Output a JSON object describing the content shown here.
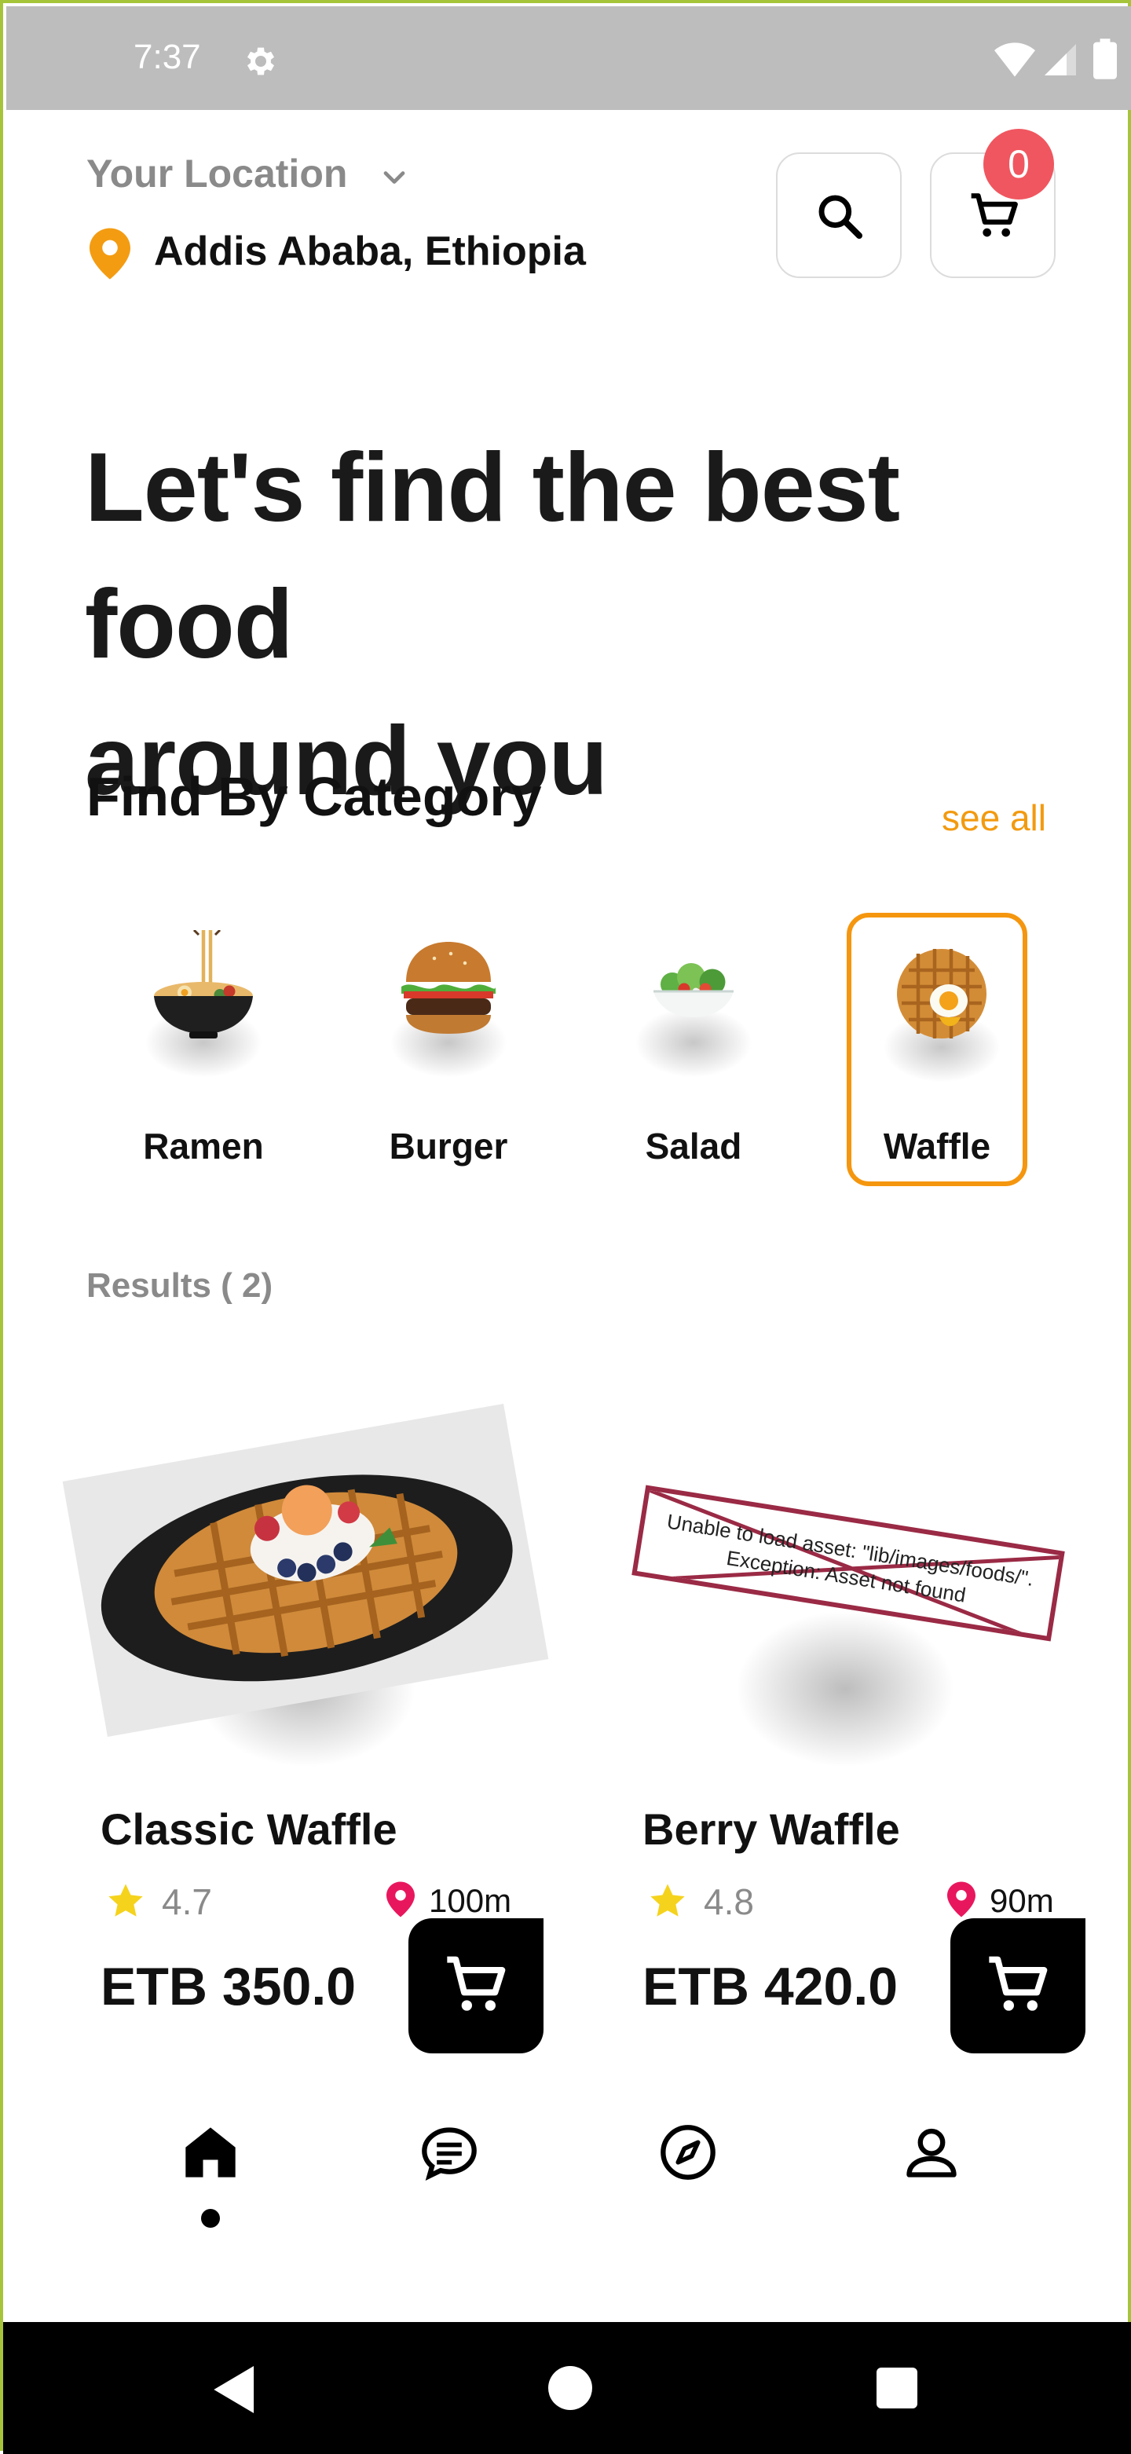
{
  "status_bar": {
    "time": "7:37",
    "icons": [
      "gear-icon",
      "wifi-icon",
      "signal-icon",
      "battery-icon"
    ]
  },
  "header": {
    "location_label": "Your Location",
    "location_value": "Addis Ababa, Ethiopia",
    "cart_count": "0"
  },
  "hero": {
    "line1": "Let's find the best food",
    "line2": "around you"
  },
  "categories": {
    "title": "Find By Category",
    "see_all": "see all",
    "items": [
      {
        "label": "Ramen",
        "icon": "ramen-image"
      },
      {
        "label": "Burger",
        "icon": "burger-image"
      },
      {
        "label": "Salad",
        "icon": "salad-image"
      },
      {
        "label": "Waffle",
        "icon": "waffle-image",
        "selected": true
      }
    ]
  },
  "results": {
    "label": "Results ( 2)",
    "items": [
      {
        "name": "Classic Waffle",
        "rating": "4.7",
        "distance": "100m",
        "price": "ETB 350.0"
      },
      {
        "name": "Berry Waffle",
        "rating": "4.8",
        "distance": "90m",
        "price": "ETB 420.0",
        "image_error": "Unable to load asset: \"lib/images/foods/\".\nException: Asset not found"
      }
    ]
  },
  "bottom_nav": {
    "items": [
      "home-icon",
      "chat-icon",
      "explore-icon",
      "profile-icon"
    ],
    "active": "home-icon"
  },
  "colors": {
    "accent": "#f29a0f",
    "badge": "#f0565f",
    "pin": "#e8175d",
    "star": "#f5d31d"
  }
}
